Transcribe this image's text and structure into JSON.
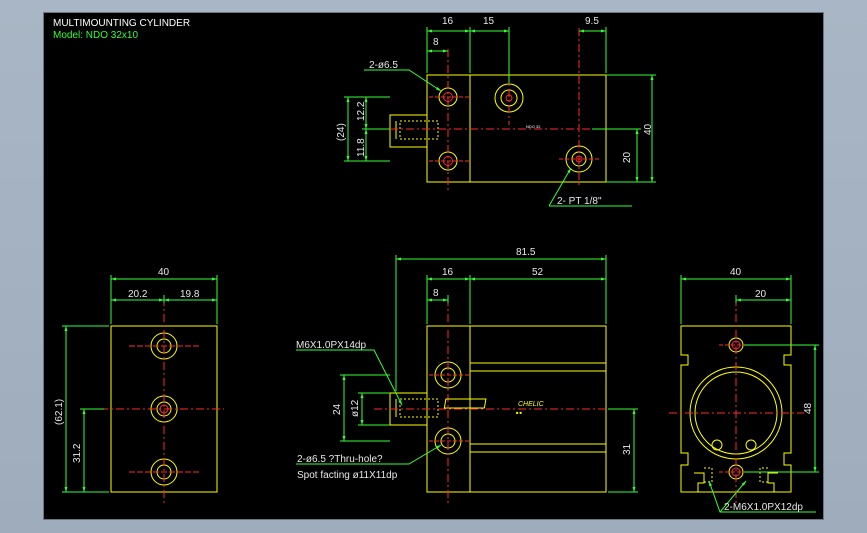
{
  "title": {
    "line1": "MULTIMOUNTING CYLINDER",
    "line2": "Model:  NDO  32x10"
  },
  "colors": {
    "background": "#000000",
    "outline": "#ffff00",
    "dimension": "#33ff33",
    "centerline": "#ff2a2a",
    "text": "#e8e8e8"
  },
  "top_view": {
    "dims": {
      "d16": "16",
      "d15": "15",
      "d9_5": "9.5",
      "d8": "8",
      "d40": "40",
      "d20": "20",
      "d24": "(24)",
      "d12_2": "12.2",
      "d11_8": "11.8"
    },
    "hole_label": "2-ø6.5",
    "port_label": "2-  PT 1/8\"",
    "model_mark": "NDO 32"
  },
  "front_view": {
    "dims": {
      "d81_5": "81.5",
      "d16": "16",
      "d52": "52",
      "d8": "8",
      "d24": "24",
      "d12": "ø12",
      "d31": "31"
    },
    "thread_label": "M6X1.0PX14dp",
    "hole_label": "2-ø6.5 ?Thru-hole?",
    "spot_label": "Spot facting   ø11X11dp",
    "badge": "CHELIC"
  },
  "side_view": {
    "dims": {
      "d40": "40",
      "d20_2": "20.2",
      "d19_8": "19.8",
      "d62_1": "(62.1)",
      "d31_2": "31.2"
    }
  },
  "end_view": {
    "dims": {
      "d40": "40",
      "d20": "20",
      "d48": "48"
    },
    "thread_label": "2-M6X1.0PX12dp"
  }
}
